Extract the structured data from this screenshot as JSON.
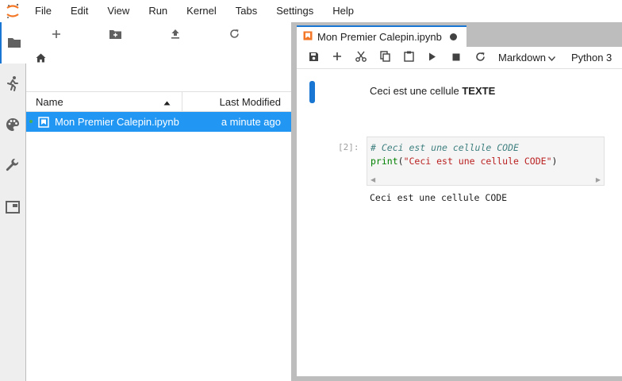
{
  "menubar": {
    "logo_icon": "jupyter-logo-icon",
    "items": [
      "File",
      "Edit",
      "View",
      "Run",
      "Kernel",
      "Tabs",
      "Settings",
      "Help"
    ]
  },
  "activitybar": {
    "items": [
      {
        "icon": "folder-icon",
        "active": true
      },
      {
        "icon": "running-icon",
        "active": false
      },
      {
        "icon": "palette-icon",
        "active": false
      },
      {
        "icon": "wrench-icon",
        "active": false
      },
      {
        "icon": "tabs-icon",
        "active": false
      }
    ]
  },
  "filebrowser": {
    "toolbar": [
      "new-launcher-icon",
      "new-folder-icon",
      "upload-icon",
      "refresh-icon"
    ],
    "breadcrumb_icon": "home-icon",
    "columns": {
      "name": "Name",
      "modified": "Last Modified"
    },
    "files": [
      {
        "name": "Mon Premier Calepin.ipynb",
        "modified": "a minute ago",
        "selected": true,
        "running": true
      }
    ]
  },
  "tabs": [
    {
      "label": "Mon Premier Calepin.ipynb",
      "dirty": true
    }
  ],
  "notebook": {
    "toolbar": {
      "cell_type": "Markdown",
      "kernel": "Python 3"
    },
    "cells": {
      "markdown": {
        "text_plain": "Ceci est une cellule ",
        "text_bold": "TEXTE"
      },
      "code": {
        "prompt": "[2]:",
        "comment": "# Ceci est une cellule CODE",
        "keyword": "print",
        "paren_open": "(",
        "string": "\"Ceci est une cellule CODE\"",
        "paren_close": ")",
        "output": "Ceci est une cellule CODE"
      }
    }
  },
  "colors": {
    "accent": "#1976d2",
    "selection": "#2196f3",
    "logo_orange": "#f37726"
  }
}
